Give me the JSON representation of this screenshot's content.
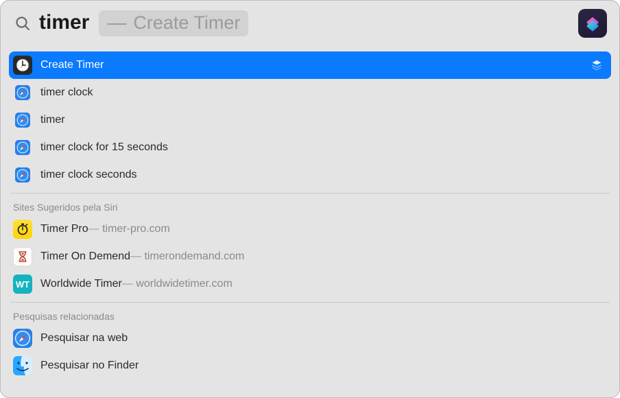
{
  "search": {
    "query": "timer",
    "ghost_dash": "—",
    "ghost_text": "Create Timer"
  },
  "top_hit": {
    "title": "Create Timer"
  },
  "suggestions": [
    {
      "title": "timer clock"
    },
    {
      "title": "timer"
    },
    {
      "title": "timer clock for 15 seconds"
    },
    {
      "title": "timer clock seconds"
    }
  ],
  "sections": {
    "siri_sites_header": "Sites Sugeridos pela Siri",
    "related_header": "Pesquisas relacionadas"
  },
  "siri_sites": [
    {
      "title": "Timer Pro",
      "sub": "timer-pro.com",
      "badge": "yellow"
    },
    {
      "title": "Timer On Demend",
      "sub": "timerondemand.com",
      "badge": "white"
    },
    {
      "title": "Worldwide Timer",
      "sub": "worldwidetimer.com",
      "badge": "teal",
      "badge_text": "WT"
    }
  ],
  "related": [
    {
      "title": "Pesquisar na web",
      "icon": "safari"
    },
    {
      "title": "Pesquisar no Finder",
      "icon": "finder"
    }
  ]
}
